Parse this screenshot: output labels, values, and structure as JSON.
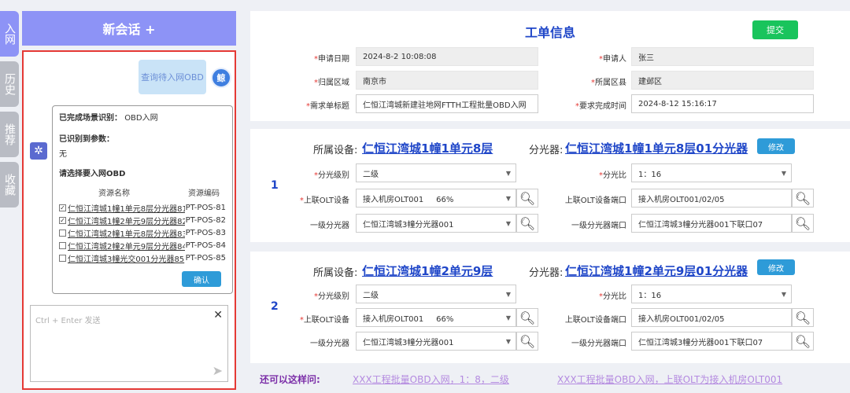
{
  "sidebar": {
    "tabs": [
      {
        "label": "入网",
        "active": true
      },
      {
        "label": "历史",
        "active": false
      },
      {
        "label": "推荐",
        "active": false
      },
      {
        "label": "收藏",
        "active": false
      }
    ]
  },
  "chat": {
    "new_chat_label": "新会话 +",
    "user_message": "查询待入网OBD",
    "user_avatar_text": "鲸",
    "bot": {
      "scene_label": "已完成场景识别：",
      "scene_value": "OBD入网",
      "params_label": "已识别到参数：",
      "params_value": "无",
      "prompt": "请选择要入网OBD",
      "col_name": "资源名称",
      "col_code": "资源编码",
      "rows": [
        {
          "checked": true,
          "name": "仁恒江湾城1幢1单元8层分光器81",
          "code": "PT-POS-81"
        },
        {
          "checked": true,
          "name": "仁恒江湾城1幢2单元9层分光器82",
          "code": "PT-POS-82"
        },
        {
          "checked": false,
          "name": "仁恒江湾城2幢1单元8层分光器83",
          "code": "PT-POS-83"
        },
        {
          "checked": false,
          "name": "仁恒江湾城2幢2单元9层分光器84",
          "code": "PT-POS-84"
        },
        {
          "checked": false,
          "name": "仁恒江湾城3幢光交001分光器85",
          "code": "PT-POS-85"
        }
      ],
      "confirm_label": "确认"
    },
    "input_placeholder": "Ctrl + Enter 发送"
  },
  "order": {
    "title": "工单信息",
    "submit_label": "提交",
    "apply_date_label": "申请日期",
    "apply_date": "2024-8-2 10:08:08",
    "applicant_label": "申请人",
    "applicant": "张三",
    "region_label": "归属区域",
    "region": "南京市",
    "district_label": "所属区县",
    "district": "建邺区",
    "req_title_label": "需求单标题",
    "req_title": "仁恒江湾城新建驻地网FTTH工程批量OBD入网",
    "due_label": "要求完成时间",
    "due": "2024-8-12 15:16:17"
  },
  "devices": [
    {
      "index": "1",
      "device_label": "所属设备:",
      "device": "仁恒江湾城1幢1单元8层",
      "splitter_label": "分光器:",
      "splitter": "仁恒江湾城1幢1单元8层01分光器",
      "edit_label": "修改",
      "level_label": "分光级别",
      "level": "二级",
      "ratio_label": "分光比",
      "ratio": "1：16",
      "olt_label": "上联OLT设备",
      "olt": "接入机房OLT001     66%",
      "olt_port_label": "上联OLT设备端口",
      "olt_port": "接入机房OLT001/02/05",
      "l1_label": "一级分光器",
      "l1": "仁恒江湾城3幢分光器001",
      "l1_port_label": "一级分光器端口",
      "l1_port": "仁恒江湾城3幢分光器001下联口07"
    },
    {
      "index": "2",
      "device_label": "所属设备:",
      "device": "仁恒江湾城1幢2单元9层",
      "splitter_label": "分光器:",
      "splitter": "仁恒江湾城1幢2单元9层01分光器",
      "edit_label": "修改",
      "level_label": "分光级别",
      "level": "二级",
      "ratio_label": "分光比",
      "ratio": "1：16",
      "olt_label": "上联OLT设备",
      "olt": "接入机房OLT001     66%",
      "olt_port_label": "上联OLT设备端口",
      "olt_port": "接入机房OLT001/02/05",
      "l1_label": "一级分光器",
      "l1": "仁恒江湾城3幢分光器001",
      "l1_port_label": "一级分光器端口",
      "l1_port": "仁恒江湾城3幢分光器001下联口07"
    }
  ],
  "suggestions": {
    "label": "还可以这样问:",
    "items": [
      "XXX工程批量OBD入网，1：8，二级",
      "XXX工程批量OBD入网，上联OLT为接入机房OLT001"
    ]
  }
}
